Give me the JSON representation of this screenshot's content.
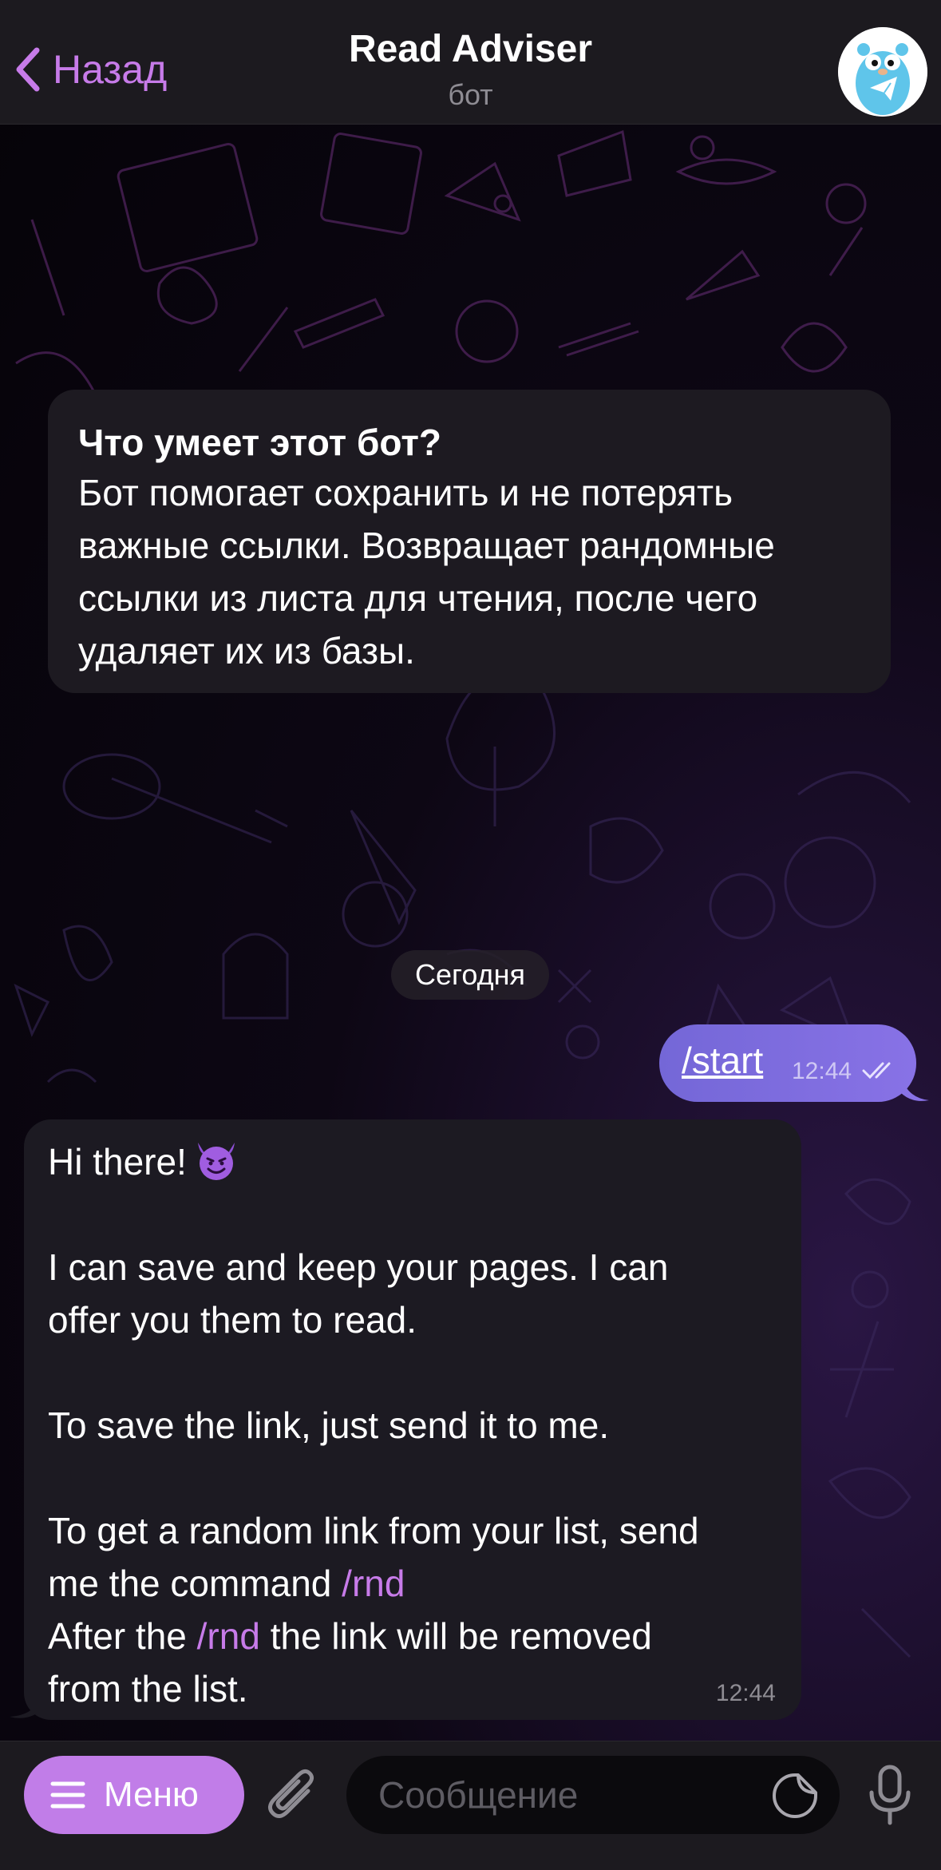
{
  "header": {
    "back_label": "Назад",
    "title": "Read Adviser",
    "subtitle": "бот"
  },
  "info_card": {
    "title": "Что умеет этот бот?",
    "lines": [
      "Бот помогает сохранить и не потерять",
      "важные ссылки. Возвращает рандомные",
      "ссылки из листа для чтения, после чего",
      "удаляет их из базы."
    ]
  },
  "date_separator": "Сегодня",
  "outgoing": {
    "text": "/start",
    "time": "12:44"
  },
  "incoming": {
    "line1": "Hi there!",
    "line2": "I can save and keep your pages. I can",
    "line3": "offer you them to read.",
    "line4": "To save the link, just send it to me.",
    "line5": "To get a random link from your list, send",
    "line6_prefix": "me the command ",
    "line6_cmd": "/rnd",
    "line7_prefix": "After the ",
    "line7_cmd": "/rnd",
    "line7_suffix": " the link will be removed",
    "line8": "from the list.",
    "time": "12:44"
  },
  "bottom_bar": {
    "menu_label": "Меню",
    "input_placeholder": "Сообщение"
  },
  "colors": {
    "accent": "#c77be9",
    "outgoing_bubble": "#7d6bdf",
    "incoming_bubble": "#1c1a22",
    "bar": "#1c1a1f"
  },
  "icons": [
    "chevron-left-icon",
    "bot-avatar-icon",
    "double-check-icon",
    "devil-emoji-icon",
    "menu-lines-icon",
    "paperclip-icon",
    "sticker-icon",
    "microphone-icon"
  ]
}
